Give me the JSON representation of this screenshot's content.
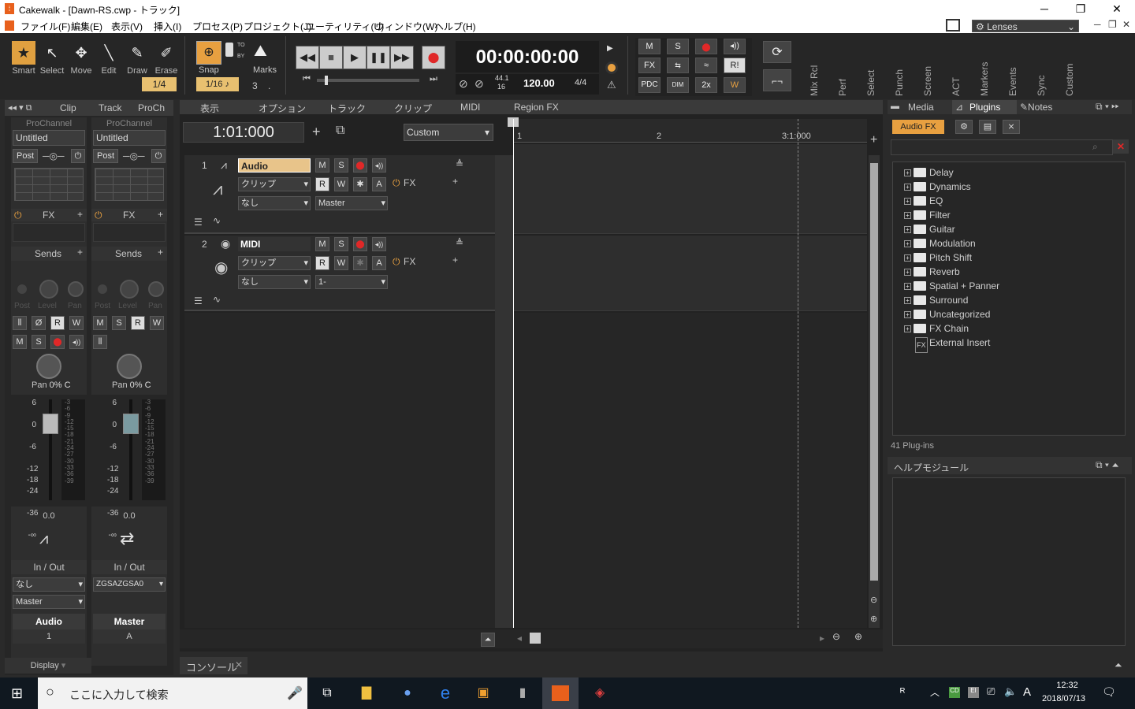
{
  "window": {
    "title": "Cakewalk - [Dawn-RS.cwp - トラック]",
    "min": "─",
    "max": "❐",
    "close": "✕"
  },
  "menu": [
    "ファイル(F)",
    "編集(E)",
    "表示(V)",
    "挿入(I)",
    "プロセス(P)",
    "プロジェクト(J)",
    "ユーティリティ(U)",
    "ウィンドウ(W)",
    "ヘルプ(H)"
  ],
  "lens": "Lenses",
  "tools": [
    {
      "label": "Smart",
      "icon": "★"
    },
    {
      "label": "Select",
      "icon": "↖"
    },
    {
      "label": "Move",
      "icon": "✥"
    },
    {
      "label": "Edit",
      "icon": "╲"
    },
    {
      "label": "Draw",
      "icon": "✎"
    },
    {
      "label": "Erase",
      "icon": "✐"
    }
  ],
  "snap": {
    "label": "Snap",
    "value": "1/4",
    "note": "1/16",
    "count": "3",
    "marks": "Marks",
    "to": "TO",
    "by": "BY"
  },
  "transport": {
    "time": "00:00:00:00",
    "sample": "44.1",
    "bits": "16",
    "tempo": "120.00",
    "meter": "4/4"
  },
  "mix": {
    "m": "M",
    "s": "S",
    "fx": "FX",
    "pdc": "PDC",
    "dim": "DIM",
    "x2": "2x",
    "ri": "R!"
  },
  "modules": [
    "Mix Rcl",
    "Perf",
    "Select",
    "Punch",
    "Screen",
    "ACT",
    "Markers",
    "Events",
    "Sync",
    "Custom"
  ],
  "inspector": {
    "tabs": [
      "Clip",
      "Track",
      "ProCh"
    ],
    "strips": [
      {
        "preset": "Untitled",
        "post": "Post",
        "fx": "FX",
        "sends": "Sends",
        "pan": "Pan",
        "pan_val": "0% C",
        "value": "0.0",
        "io": "In / Out",
        "input": "なし",
        "output": "Master",
        "name": "Audio",
        "num": "1"
      },
      {
        "preset": "Untitled",
        "post": "Post",
        "fx": "FX",
        "sends": "Sends",
        "pan": "Pan",
        "pan_val": "0% C",
        "value": "0.0",
        "io": "In / Out",
        "input": "ZGSAZGSA0",
        "output": "",
        "name": "Master",
        "num": "A"
      }
    ],
    "pc_label": "ProChannel",
    "post_l": "Post",
    "level": "Level",
    "pan": "Pan",
    "display": "Display"
  },
  "trackview": {
    "menus": [
      "表示",
      "オプション",
      "トラック",
      "クリップ",
      "MIDI",
      "Region FX"
    ],
    "now": "1:01:000",
    "custom": "Custom",
    "ruler": [
      "1",
      "2",
      "3:1:000"
    ]
  },
  "tracks": [
    {
      "num": "1",
      "name": "Audio",
      "clip": "クリップ",
      "input": "なし",
      "output": "Master",
      "fx": "FX"
    },
    {
      "num": "2",
      "name": "MIDI",
      "clip": "クリップ",
      "input": "なし",
      "output": "1-",
      "fx": "FX"
    }
  ],
  "btn": {
    "m": "M",
    "s": "S",
    "r": "R",
    "w": "W",
    "a": "A"
  },
  "browser": {
    "tabs": [
      "Media",
      "Plugins",
      "Notes"
    ],
    "filter": "Audio FX",
    "folders": [
      "Delay",
      "Dynamics",
      "EQ",
      "Filter",
      "Guitar",
      "Modulation",
      "Pitch Shift",
      "Reverb",
      "Spatial + Panner",
      "Surround",
      "Uncategorized",
      "FX Chain"
    ],
    "external": "External Insert",
    "count": "41 Plug-ins"
  },
  "help": {
    "title": "ヘルプモジュール"
  },
  "console": {
    "label": "コンソール"
  },
  "taskbar": {
    "search": "ここに入力して検索",
    "time": "12:32",
    "date": "2018/07/13",
    "ime": "A"
  }
}
